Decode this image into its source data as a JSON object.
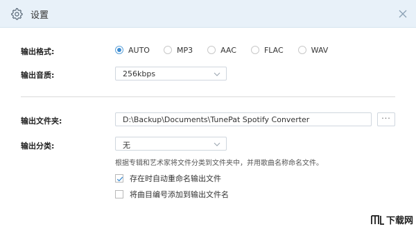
{
  "window": {
    "title": "设置",
    "title_icon": "gear-icon",
    "close_icon": "close-icon"
  },
  "output_format": {
    "label": "输出格式:",
    "selected": "AUTO",
    "options": [
      "AUTO",
      "MP3",
      "AAC",
      "FLAC",
      "WAV"
    ]
  },
  "output_quality": {
    "label": "输出音质:",
    "value": "256kbps"
  },
  "output_folder": {
    "label": "输出文件夹:",
    "value": "D:\\Backup\\Documents\\TunePat Spotify Converter",
    "browse_label": "···"
  },
  "output_category": {
    "label": "输出分类:",
    "value": "无",
    "hint": "根据专辑和艺术家将文件分类到文件夹中，并用歌曲名称命名文件。"
  },
  "options": {
    "rename_if_exists": {
      "label": "存在时自动重命名输出文件",
      "checked": true
    },
    "add_track_number": {
      "label": "将曲目编号添加到输出文件名",
      "checked": false
    }
  },
  "watermark": {
    "text": "下载网",
    "logo": "watermark-logo"
  },
  "colors": {
    "titlebar_bg": "#e8f1f9",
    "accent": "#3d8cd2",
    "border": "#cfd6de"
  }
}
